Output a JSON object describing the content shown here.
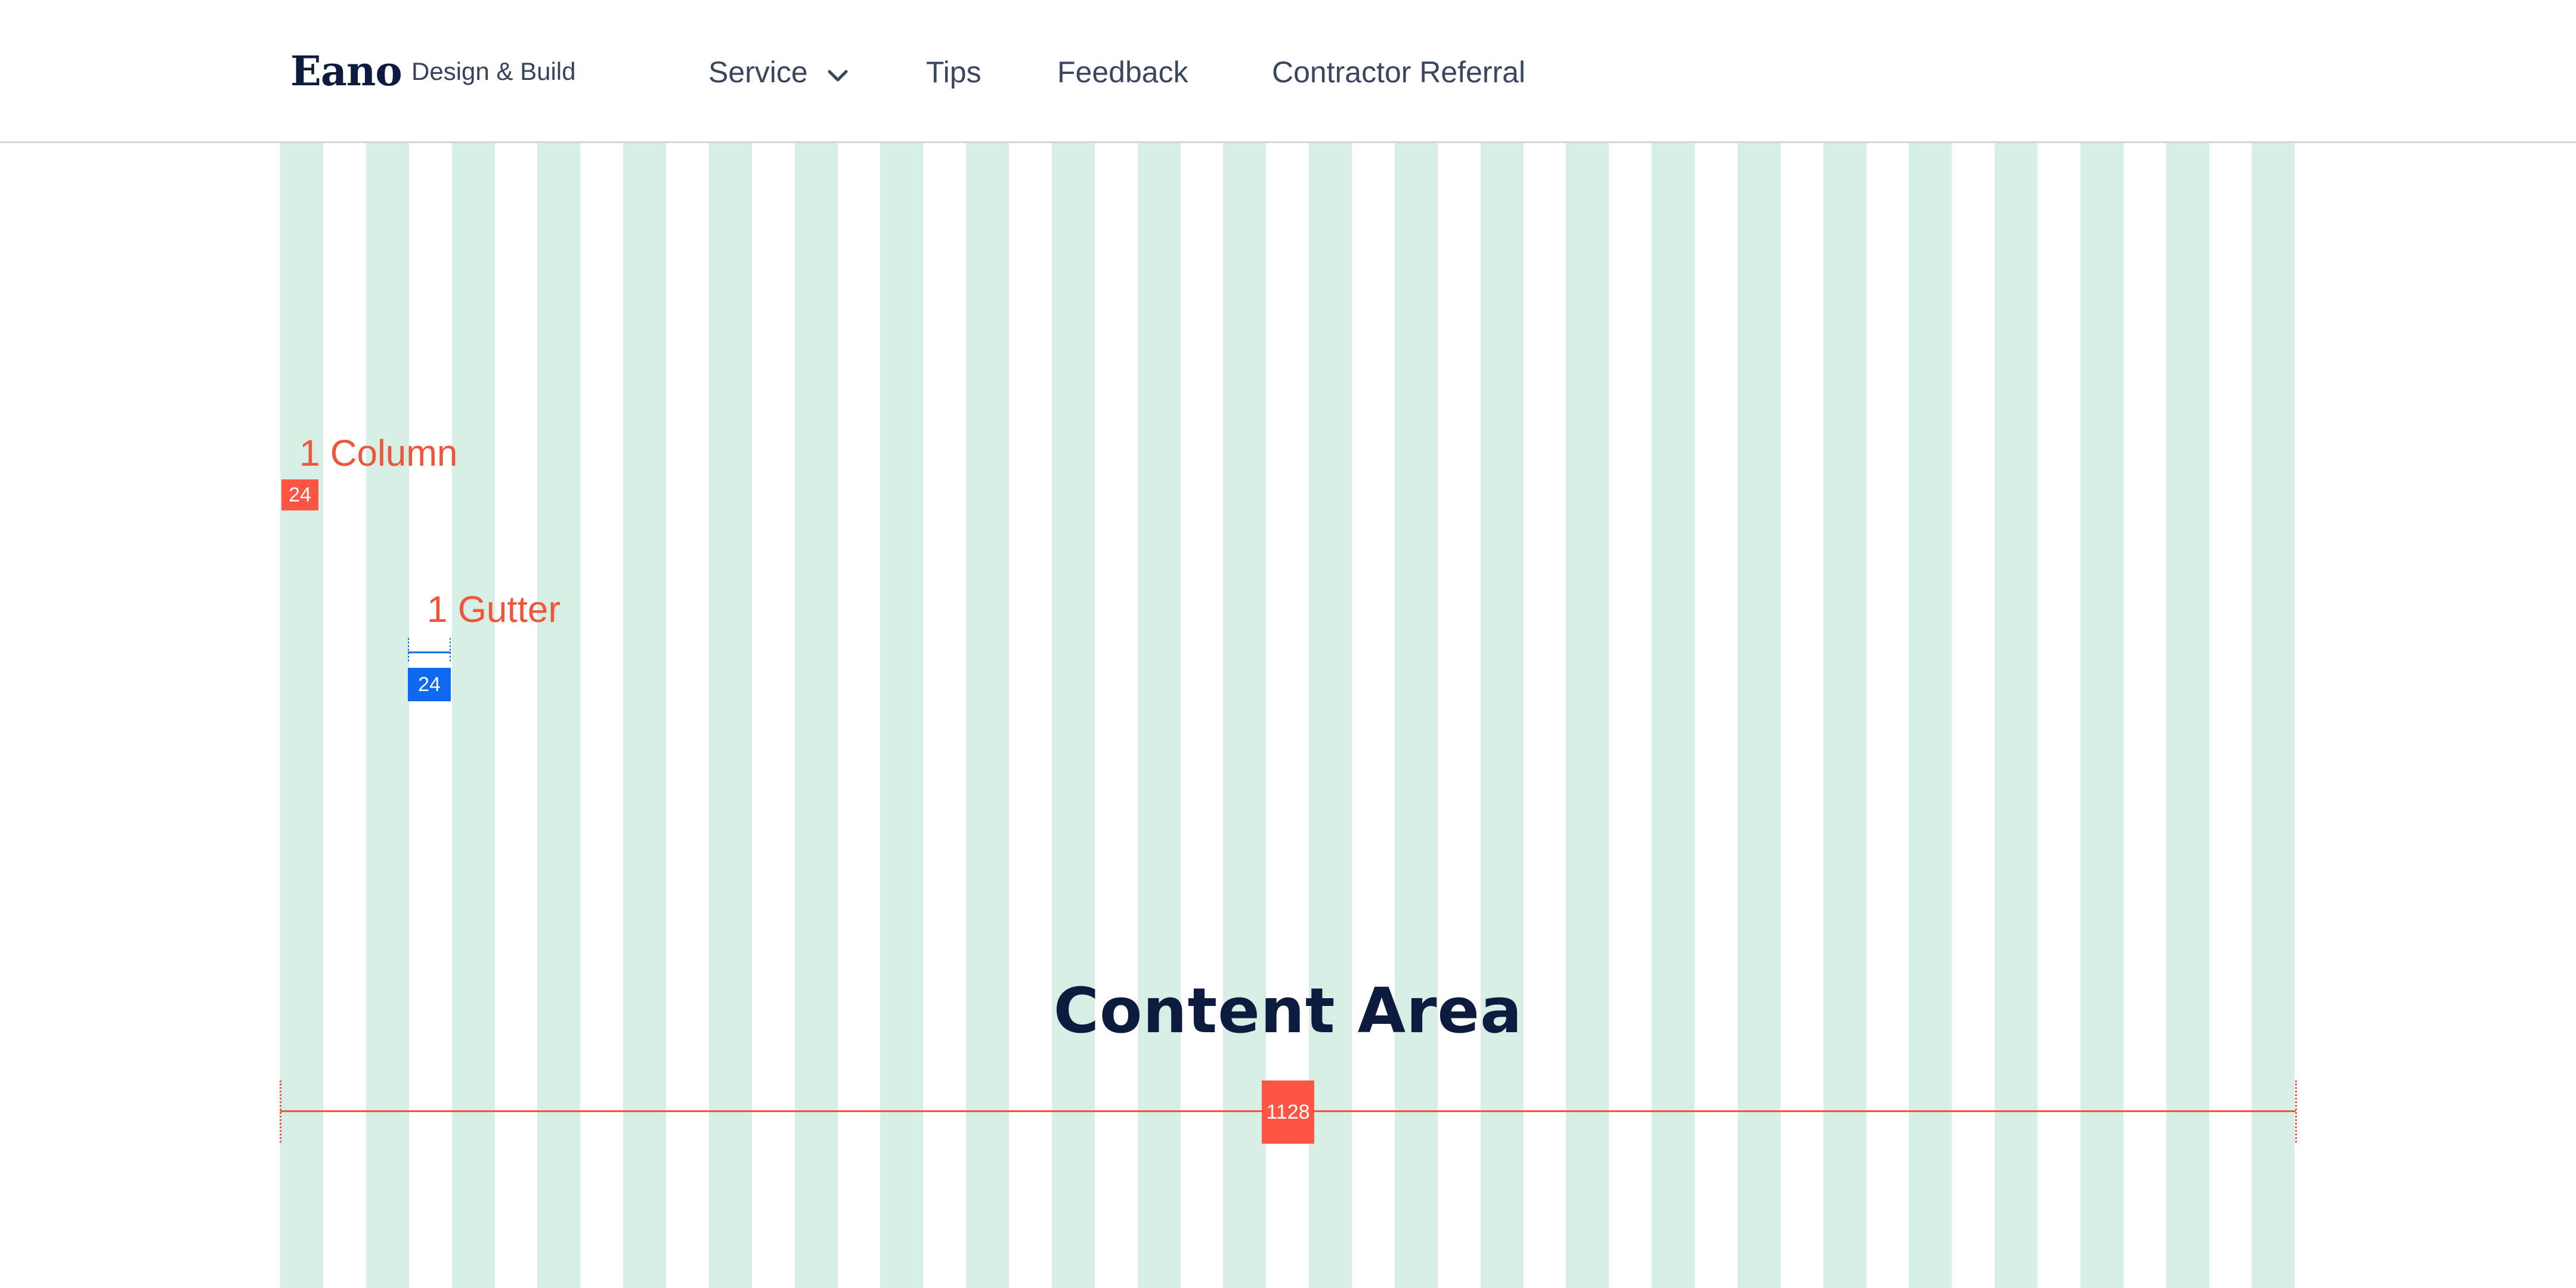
{
  "header": {
    "logo": "Eano",
    "tagline": "Design & Build",
    "nav": {
      "service": "Service",
      "tips": "Tips",
      "feedback": "Feedback",
      "referral": "Contractor Referral"
    }
  },
  "annotations": {
    "column_label": "1 Column",
    "column_width": "24",
    "gutter_label": "1 Gutter",
    "gutter_width": "24",
    "content_title": "Content Area",
    "content_width": "1128"
  },
  "grid": {
    "column_count": 24,
    "column_color": "#d7eee5"
  },
  "colors": {
    "brand_navy": "#0d1b3e",
    "annotation_red": "#f0543b",
    "badge_red": "#fc5543",
    "badge_blue": "#0d69f2"
  },
  "icons": {
    "service_dropdown": "chevron-down-icon"
  }
}
